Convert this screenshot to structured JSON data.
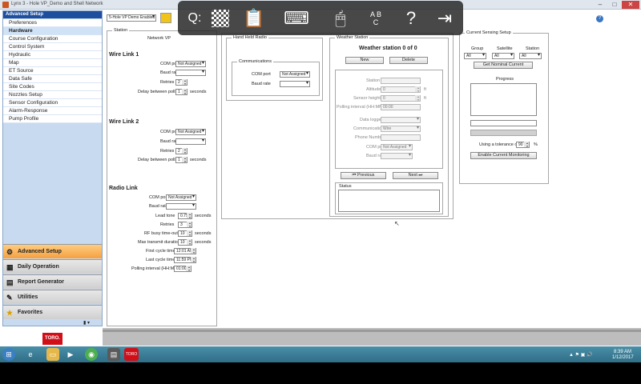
{
  "window": {
    "title": "Lynx 3 - Hole VP_Demo and Shell Network"
  },
  "sidebar": {
    "header": "Advanced Setup",
    "items": [
      {
        "label": "Preferences",
        "selected": false
      },
      {
        "label": "Hardware",
        "selected": true
      },
      {
        "label": "Course Configuration",
        "selected": false
      },
      {
        "label": "Control System",
        "selected": false
      },
      {
        "label": "Hydraulic",
        "selected": false
      },
      {
        "label": "Map",
        "selected": false
      },
      {
        "label": "ET Source",
        "selected": false
      },
      {
        "label": "Data Safe",
        "selected": false
      },
      {
        "label": "Site Codes",
        "selected": false
      },
      {
        "label": "Nozzles Setup",
        "selected": false
      },
      {
        "label": "Sensor Configuration",
        "selected": false
      },
      {
        "label": "Alarm-Response",
        "selected": false
      },
      {
        "label": "Pump Profile",
        "selected": false
      }
    ],
    "nav": [
      {
        "label": "Advanced Setup",
        "icon": "gear-icon",
        "active": true
      },
      {
        "label": "Daily Operation",
        "icon": "calendar-icon",
        "active": false
      },
      {
        "label": "Report Generator",
        "icon": "report-icon",
        "active": false
      },
      {
        "label": "Utilities",
        "icon": "wrench-icon",
        "active": false
      },
      {
        "label": "Favorites",
        "icon": "star-icon",
        "active": false
      }
    ],
    "logo": "TORO."
  },
  "toolbar": {
    "site_select": "5-Hole VP Demo Enabled"
  },
  "overlay": {
    "icons": [
      "zoom-icon",
      "checkerboard-icon",
      "clipboard-icon",
      "keyboard-icon",
      "mouse-icon",
      "abc-keys-icon",
      "help-icon",
      "exit-icon"
    ],
    "zoom_label": "Q:"
  },
  "station": {
    "legend": "Station",
    "network_label": "Network VP"
  },
  "wire_link_1": {
    "title": "Wire Link 1",
    "com_port_label": "COM port",
    "com_port_value": "Not Assigned",
    "baud_label": "Baud rate",
    "baud_value": "",
    "retries_label": "Retries",
    "retries_value": "2",
    "delay_label": "Delay between polls",
    "delay_value": "1",
    "delay_unit": "seconds"
  },
  "wire_link_2": {
    "title": "Wire Link 2",
    "com_port_label": "COM port",
    "com_port_value": "Not Assigned",
    "baud_label": "Baud rate",
    "baud_value": "",
    "retries_label": "Retries",
    "retries_value": "2",
    "delay_label": "Delay between polls",
    "delay_value": "1",
    "delay_unit": "seconds"
  },
  "radio_link": {
    "title": "Radio Link",
    "com_port_label": "COM port",
    "com_port_value": "Not Assigned",
    "baud_label": "Baud rate",
    "baud_value": "",
    "lead_tone_label": "Lead tone",
    "lead_tone_value": "0.75",
    "lead_tone_unit": "seconds",
    "retries_label": "Retries",
    "retries_value": "3",
    "rf_busy_label": "RF busy time-out",
    "rf_busy_value": "10",
    "rf_busy_unit": "seconds",
    "max_transmit_label": "Max transmit duration",
    "max_transmit_value": "10",
    "max_transmit_unit": "seconds",
    "first_cycle_label": "First cycle time",
    "first_cycle_value": "12:01 AM",
    "last_cycle_label": "Last cycle time",
    "last_cycle_value": "11:59 PM",
    "polling_label": "Polling interval (HH:MM)",
    "polling_value": "01:00"
  },
  "hand_held_radio": {
    "legend": "Hand Held Radio",
    "comm_legend": "Communications",
    "com_port_label": "COM port",
    "com_port_value": "Not Assigned",
    "baud_label": "Baud rate",
    "baud_value": ""
  },
  "weather_station": {
    "legend": "Weather Station",
    "title": "Weather station 0 of 0",
    "new_label": "New",
    "delete_label": "Delete",
    "station_label": "Station",
    "altitude_label": "Altitude",
    "altitude_value": "0",
    "altitude_unit": "ft",
    "sensor_height_label": "Sensor height",
    "sensor_height_value": "0",
    "sensor_height_unit": "ft",
    "polling_label": "Polling interval (HH:MM)",
    "polling_value": "00:00",
    "datalogger_label": "Data logger",
    "communication_label": "Communication",
    "communication_value": "Wire",
    "phone_label": "Phone Number",
    "com_port_label": "COM port",
    "com_port_value": "Not Assigned",
    "baud_label": "Baud rate",
    "previous_label": "Previous",
    "next_label": "Next",
    "status_legend": "Status"
  },
  "current_sensing": {
    "legend": "Current Sensing Setup",
    "group_label": "Group",
    "satellite_label": "Satellite",
    "station_label": "Station",
    "group_value": "All",
    "satellite_value": "All",
    "station_value": "All",
    "get_nominal_label": "Get Nominal Current",
    "progress_label": "Progress",
    "tolerance_label": "Using a tolerance of",
    "tolerance_value": "90",
    "tolerance_unit": "%",
    "enable_label": "Enable Current Monitoring"
  },
  "taskbar": {
    "time": "8:39 AM",
    "date": "1/12/2017"
  }
}
